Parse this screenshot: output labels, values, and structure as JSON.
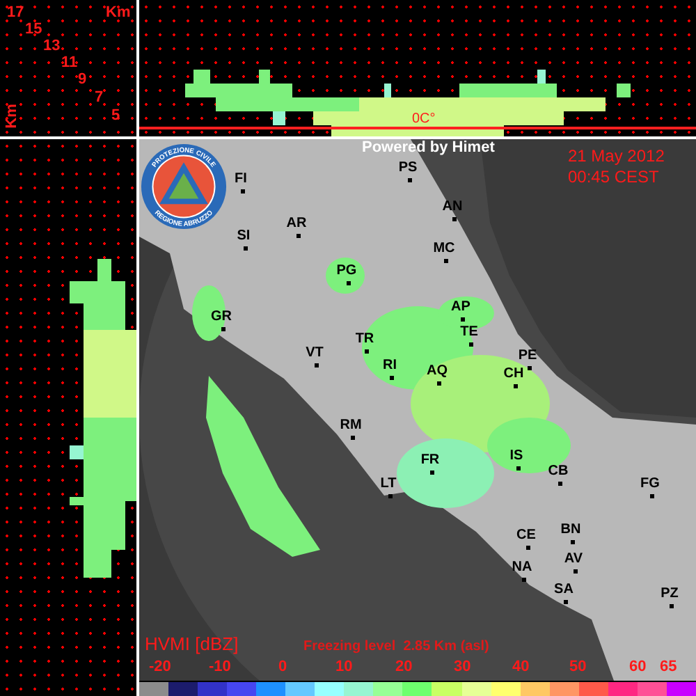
{
  "corner": {
    "heights": [
      "17",
      "15",
      "13",
      "11",
      "9",
      "7",
      "5"
    ],
    "unit_top": "Km",
    "unit_side": "Km"
  },
  "profile": {
    "freezing_label": "0C°"
  },
  "map": {
    "credit": "Powered by Himet",
    "date": "21 May 2012",
    "time": "00:45 CEST",
    "logo": {
      "top_text": "PROTEZIONE CIVILE",
      "bottom_text": "REGIONE ABRUZZO"
    },
    "cities": [
      {
        "label": "FI"
      },
      {
        "label": "SI"
      },
      {
        "label": "AR"
      },
      {
        "label": "PS"
      },
      {
        "label": "AN"
      },
      {
        "label": "MC"
      },
      {
        "label": "PG"
      },
      {
        "label": "AP"
      },
      {
        "label": "GR"
      },
      {
        "label": "TE"
      },
      {
        "label": "TR"
      },
      {
        "label": "PE"
      },
      {
        "label": "VT"
      },
      {
        "label": "RI"
      },
      {
        "label": "AQ"
      },
      {
        "label": "CH"
      },
      {
        "label": "RM"
      },
      {
        "label": "FR"
      },
      {
        "label": "IS"
      },
      {
        "label": "CB"
      },
      {
        "label": "LT"
      },
      {
        "label": "FG"
      },
      {
        "label": "CE"
      },
      {
        "label": "BN"
      },
      {
        "label": "AV"
      },
      {
        "label": "NA"
      },
      {
        "label": "SA"
      },
      {
        "label": "PZ"
      }
    ],
    "product": "HVMI [dBZ]",
    "freezing_level": "Freezing level  2.85 Km (asl)"
  },
  "legend": {
    "ticks": [
      "-20",
      "-10",
      "0",
      "10",
      "20",
      "30",
      "40",
      "50",
      "60",
      "65"
    ],
    "bins": [
      {
        "color": "#8c8c8c"
      },
      {
        "color": "#1c1c6c"
      },
      {
        "color": "#3232c8"
      },
      {
        "color": "#4646f0"
      },
      {
        "color": "#1e90ff"
      },
      {
        "color": "#64c8ff"
      },
      {
        "color": "#96ffff"
      },
      {
        "color": "#96f5d2"
      },
      {
        "color": "#96ff96"
      },
      {
        "color": "#6eff6e"
      },
      {
        "color": "#c8ff64"
      },
      {
        "color": "#e6ff96"
      },
      {
        "color": "#ffff6e"
      },
      {
        "color": "#ffc864"
      },
      {
        "color": "#ff9664"
      },
      {
        "color": "#ff5a4a"
      },
      {
        "color": "#ff2882"
      },
      {
        "color": "#ff5096"
      },
      {
        "color": "#c800ff"
      }
    ]
  }
}
